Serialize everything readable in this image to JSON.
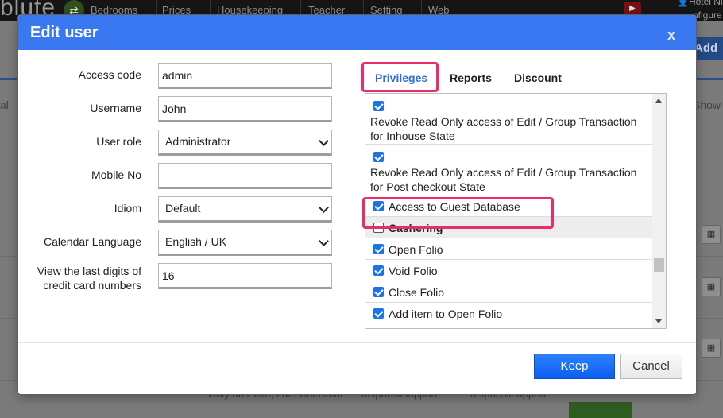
{
  "background": {
    "brand": "blute",
    "nav": [
      "Bedrooms",
      "Prices",
      "Housekeeping",
      "Teacher",
      "Setting",
      "Web"
    ],
    "hotel": "Hotel Ni",
    "configure": "nfigure",
    "add_button": "Add",
    "show_label": "Show",
    "left_tab_partial": "al",
    "footer_texts": [
      "Only on Extra, Late Checkout",
      "helpdesksupport",
      "helpdesksupport"
    ]
  },
  "modal": {
    "title": "Edit user",
    "close_label": "x",
    "form": {
      "access_code_label": "Access code",
      "access_code_value": "admin",
      "username_label": "Username",
      "username_value": "John",
      "user_role_label": "User role",
      "user_role_value": "Administrator",
      "mobile_label": "Mobile No",
      "mobile_value": "",
      "idiom_label": "Idiom",
      "idiom_value": "Default",
      "calendar_language_label": "Calendar Language",
      "calendar_language_value": "English / UK",
      "last_digits_label_line1": "View the last digits of",
      "last_digits_label_line2": "credit card numbers",
      "last_digits_value": "16"
    },
    "tabs": {
      "privileges": "Privileges",
      "reports": "Reports",
      "discount": "Discount"
    },
    "privileges": [
      {
        "checked": true,
        "line1": "Revoke Read Only access of Edit / Group Transaction",
        "line2": "for Inhouse State"
      },
      {
        "checked": true,
        "line1": "Revoke Read Only access of Edit / Group Transaction",
        "line2": "for Post checkout State"
      },
      {
        "checked": true,
        "label": "Access to Guest Database"
      },
      {
        "checked": false,
        "label": "Cashering",
        "section": true
      },
      {
        "checked": true,
        "label": "Open Folio"
      },
      {
        "checked": true,
        "label": "Void Folio"
      },
      {
        "checked": true,
        "label": "Close Folio"
      },
      {
        "checked": true,
        "label": "Add item to Open Folio"
      }
    ],
    "buttons": {
      "keep": "Keep",
      "cancel": "Cancel"
    }
  },
  "colors": {
    "header_blue": "#3a78f2",
    "highlight_pink": "#ea2d6a",
    "checkbox_blue": "#1a73e8",
    "tab_active": "#2c6fd8"
  }
}
